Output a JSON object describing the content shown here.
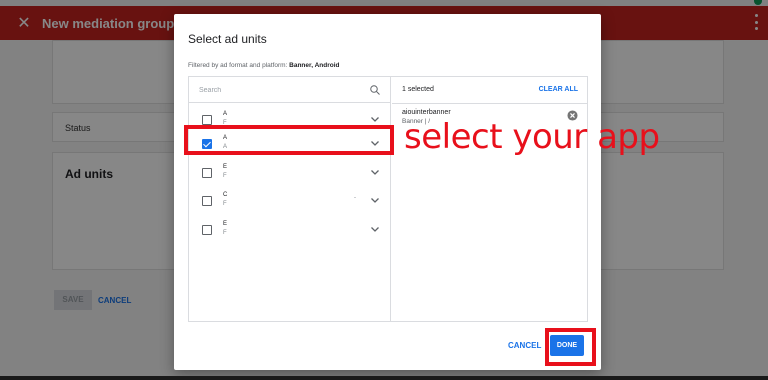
{
  "app": {
    "title": "New mediation group"
  },
  "page": {
    "status_label": "Status",
    "ad_units_heading": "Ad units",
    "save_label": "SAVE",
    "cancel_label": "CANCEL"
  },
  "dialog": {
    "title": "Select ad units",
    "filter_prefix": "Filtered by ad format and platform: ",
    "filter_value": "Banner, Android",
    "search_placeholder": "Search",
    "units": [
      {
        "name": "A",
        "sub": "F",
        "checked": false
      },
      {
        "name": "A",
        "sub": "A",
        "checked": true
      },
      {
        "name": "E",
        "sub": "F",
        "checked": false
      },
      {
        "name": "C",
        "sub": "F",
        "checked": false
      },
      {
        "name": "E",
        "sub": "F",
        "checked": false
      }
    ],
    "selected_count": "1 selected",
    "clear_all": "CLEAR ALL",
    "selected_item": {
      "name": "aiouinterbanner",
      "sub": "Banner | /"
    },
    "cancel_label": "CANCEL",
    "done_label": "DONE"
  },
  "annotation": {
    "text": "select your app",
    "color": "#e8101b"
  },
  "colors": {
    "appbar": "#c5221f",
    "accent": "#1a73e8"
  }
}
